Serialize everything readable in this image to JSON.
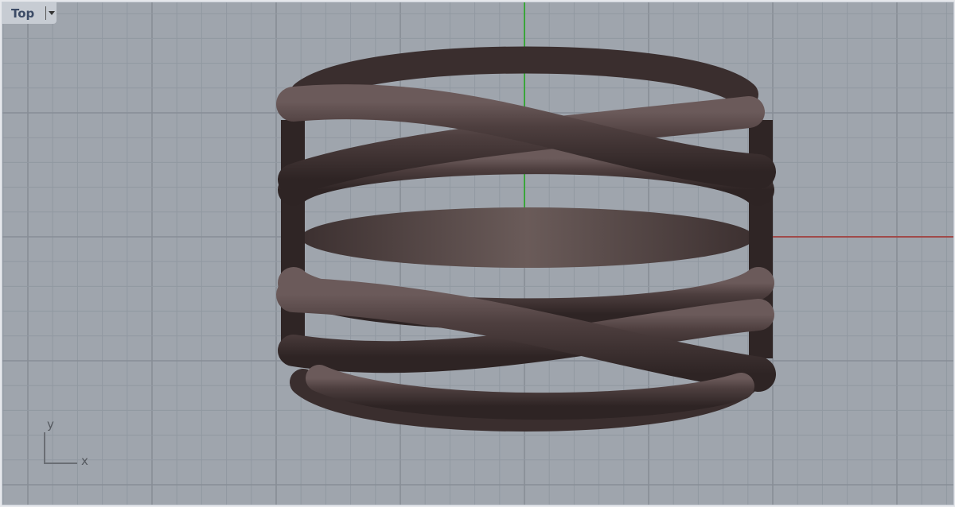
{
  "viewport": {
    "name": "Top",
    "axis_labels": {
      "x": "x",
      "y": "y"
    }
  },
  "colors": {
    "background": "#9fa5ad",
    "grid_minor": "#9198a1",
    "grid_major": "#878d96",
    "x_axis": "#a04a4a",
    "y_axis": "#3aa53a",
    "object": "#4a3c3c"
  }
}
